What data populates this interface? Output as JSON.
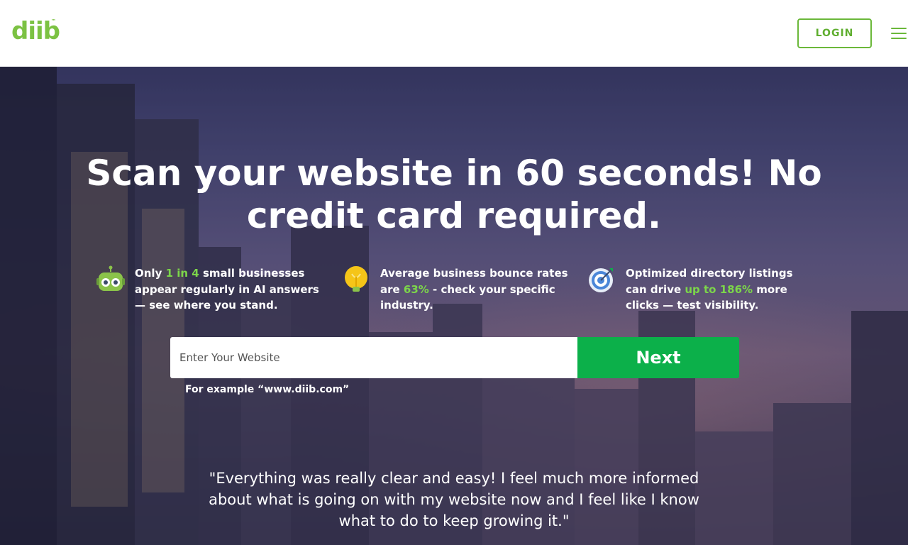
{
  "header": {
    "logo_text": "diib",
    "logo_tm": "™",
    "login_label": "LOGIN",
    "menu_icon": "hamburger-menu-icon"
  },
  "hero": {
    "headline": "Scan your website in 60 seconds! No credit card required.",
    "features": [
      {
        "icon": "robot-icon",
        "text_before": "Only ",
        "highlight": "1 in 4",
        "text_after": " small businesses appear regularly in AI answers — see where you stand."
      },
      {
        "icon": "lightbulb-icon",
        "text_before": "Average business bounce rates are ",
        "highlight": "63%",
        "text_after": " - check your specific industry."
      },
      {
        "icon": "target-icon",
        "text_before": "Optimized directory listings can drive ",
        "highlight": "up to 186%",
        "text_after": " more clicks — test visibility."
      }
    ],
    "search": {
      "placeholder": "Enter Your Website",
      "value": "",
      "button_label": "Next",
      "example": "For example “www.diib.com”"
    },
    "testimonial": "\"Everything was really clear and easy! I feel much more informed about what is going on with my website now and I feel like I know what to do to keep growing it.\""
  },
  "colors": {
    "brand_green": "#7cc243",
    "button_green": "#0cb04a",
    "highlight_green": "#7cd64a"
  }
}
